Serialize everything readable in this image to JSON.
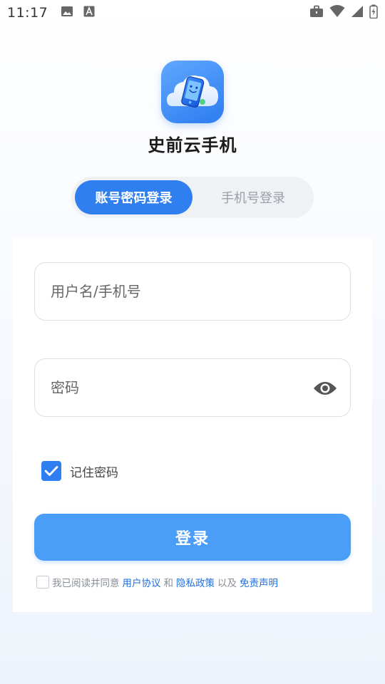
{
  "status_bar": {
    "time": "11:17",
    "left_icons": [
      "image-icon",
      "font-a-icon"
    ],
    "right_icons": [
      "briefcase-icon",
      "wifi-icon",
      "signal-icon",
      "battery-charging-icon"
    ]
  },
  "app": {
    "name": "史前云手机",
    "logo_icon": "cloud-phone-logo-icon"
  },
  "tabs": [
    {
      "label": "账号密码登录",
      "active": true
    },
    {
      "label": "手机号登录",
      "active": false
    }
  ],
  "form": {
    "username": {
      "placeholder": "用户名/手机号",
      "value": ""
    },
    "password": {
      "placeholder": "密码",
      "value": ""
    },
    "remember_label": "记住密码",
    "remember_checked": true,
    "login_label": "登录"
  },
  "agreement": {
    "checked": false,
    "prefix": "我已阅读并同意",
    "user_agreement": "用户协议",
    "and": "和",
    "privacy_policy": "隐私政策",
    "also": "以及",
    "disclaimer": "免责声明"
  },
  "colors": {
    "accent": "#2f7ff0",
    "button": "#4a9ef8",
    "link": "#1f6fde"
  }
}
